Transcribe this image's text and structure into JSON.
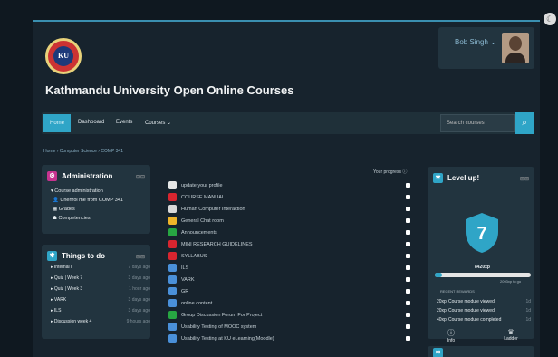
{
  "header": {
    "user_name": "Bob Singh",
    "user_caret": "⌄",
    "site_title": "Kathmandu University Open Online Courses",
    "logo_text": "KU"
  },
  "nav": {
    "home": "Home",
    "dashboard": "Dashboard",
    "events": "Events",
    "courses": "Courses",
    "search_placeholder": "Search courses"
  },
  "breadcrumb": "Home › Computer Science › COMP 341",
  "admin": {
    "title": "Administration",
    "items": [
      "▾ Course administration",
      "Unenrol me from COMP 341",
      "Grades",
      "Competencies"
    ]
  },
  "todo": {
    "title": "Things to do",
    "items": [
      {
        "label": "Internal I",
        "when": "7 days ago"
      },
      {
        "label": "Quiz | Week 7",
        "when": "3 days ago"
      },
      {
        "label": "Quiz | Week 3",
        "when": "1 hour ago"
      },
      {
        "label": "VARK",
        "when": "3 days ago"
      },
      {
        "label": "ILS",
        "when": "3 days ago"
      },
      {
        "label": "Discussion week 4",
        "when": "9 hours ago"
      }
    ]
  },
  "progress_label": "Your progress",
  "course_items": [
    {
      "label": "update your profile",
      "color": "#e6e6e6"
    },
    {
      "label": "COURSE MANUAL",
      "color": "#d9252f"
    },
    {
      "label": "Human Computer Interaction",
      "color": "#d9d9d9"
    },
    {
      "label": "General Chat room",
      "color": "#f0b429"
    },
    {
      "label": "Announcements",
      "color": "#27a642"
    },
    {
      "label": "MINI RESEARCH GUIDELINES",
      "color": "#d9252f"
    },
    {
      "label": "SYLLABUS",
      "color": "#d9252f"
    },
    {
      "label": "ILS",
      "color": "#4a90d9"
    },
    {
      "label": "VARK",
      "color": "#4a90d9"
    },
    {
      "label": "GR",
      "color": "#4a90d9"
    },
    {
      "label": "online content",
      "color": "#4a90d9"
    },
    {
      "label": "Group Discussion Forum For Project",
      "color": "#27a642"
    },
    {
      "label": "Usability Testing of MOOC system",
      "color": "#4a90d9"
    },
    {
      "label": "Usability Testing at KU eLearning(Moodle)",
      "color": "#4a90d9"
    }
  ],
  "levelup": {
    "title": "Level up!",
    "level": "7",
    "xp": "8420xp",
    "to_next": "2093xp to go",
    "progress": 0.08,
    "recent_title": "RECENT REWARDS",
    "rewards": [
      {
        "xp": "20xp",
        "text": "Course module viewed",
        "when": "1d"
      },
      {
        "xp": "20xp",
        "text": "Course module viewed",
        "when": "1d"
      },
      {
        "xp": "40xp",
        "text": "Course module completed",
        "when": "1d"
      }
    ],
    "info_label": "Info",
    "ladder_label": "Ladder"
  },
  "colors": {
    "accent": "#2fa5c7",
    "admin": "#c6338f"
  }
}
